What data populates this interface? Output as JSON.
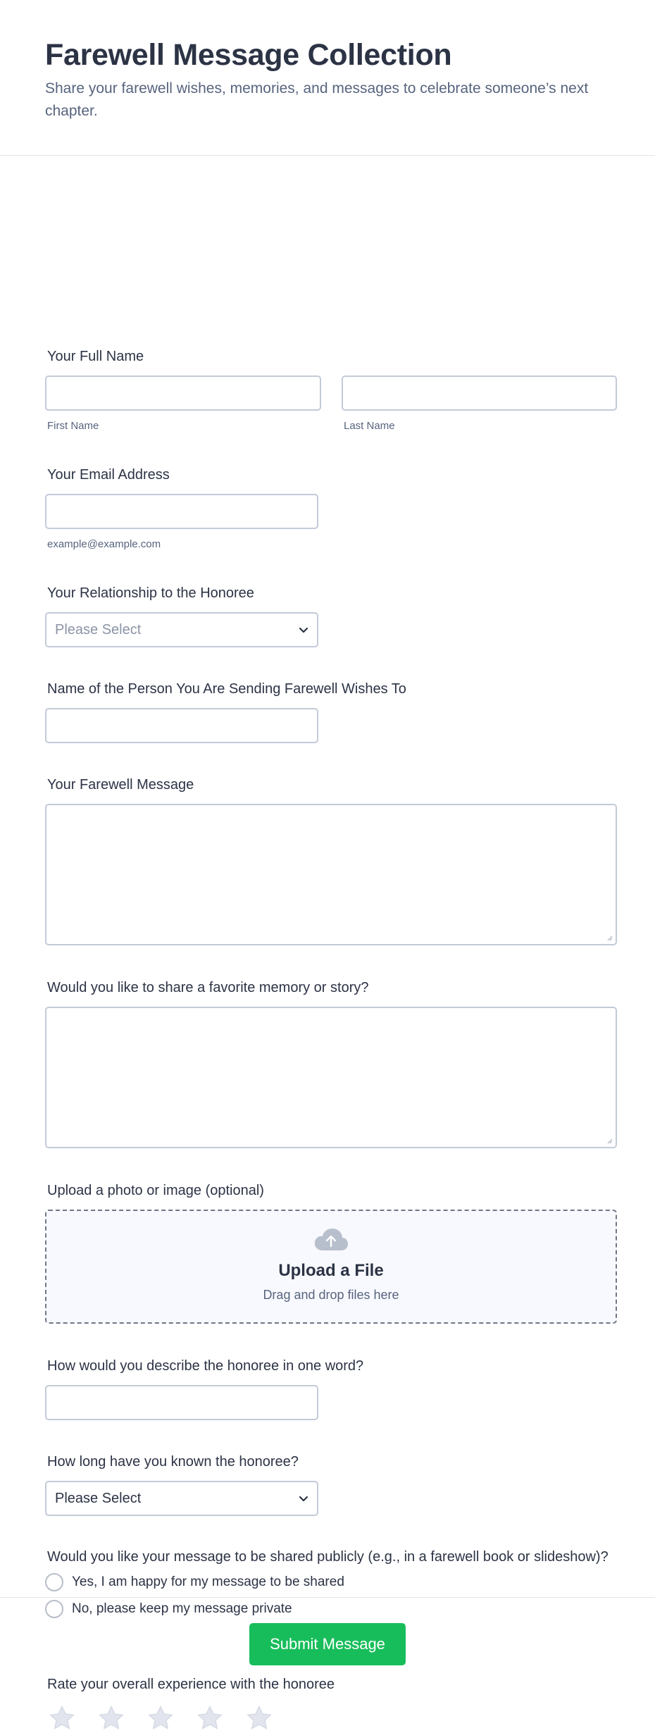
{
  "header": {
    "title": "Farewell Message Collection",
    "subtitle": "Share your farewell wishes, memories, and messages to celebrate someone’s next chapter."
  },
  "fields": {
    "full_name": {
      "label": "Your Full Name",
      "first_sublabel": "First Name",
      "last_sublabel": "Last Name",
      "first_value": "",
      "last_value": ""
    },
    "email": {
      "label": "Your Email Address",
      "sublabel": "example@example.com",
      "value": ""
    },
    "relationship": {
      "label": "Your Relationship to the Honoree",
      "selected": "Please Select"
    },
    "honoree_name": {
      "label": "Name of the Person You Are Sending Farewell Wishes To",
      "value": ""
    },
    "message": {
      "label": "Your Farewell Message",
      "value": ""
    },
    "memory": {
      "label": "Would you like to share a favorite memory or story?",
      "value": ""
    },
    "upload": {
      "label": "Upload a photo or image (optional)",
      "title": "Upload a File",
      "hint": "Drag and drop files here",
      "icon": "cloud-upload-icon"
    },
    "one_word": {
      "label": "How would you describe the honoree in one word?",
      "value": ""
    },
    "known_duration": {
      "label": "How long have you known the honoree?",
      "selected": "Please Select"
    },
    "share_publicly": {
      "label": "Would you like your message to be shared publicly (e.g., in a farewell book or slideshow)?",
      "options": [
        "Yes, I am happy for my message to be shared",
        "No, please keep my message private"
      ]
    },
    "rating": {
      "label": "Rate your overall experience with the honoree",
      "max": 5,
      "value": 0
    }
  },
  "footer": {
    "submit_label": "Submit Message"
  },
  "colors": {
    "accent": "#18bd5b",
    "text": "#2c3345",
    "muted": "#57647e",
    "border": "#c3cad8",
    "placeholder": "#8c94a6",
    "star": "#e3e5ee"
  }
}
